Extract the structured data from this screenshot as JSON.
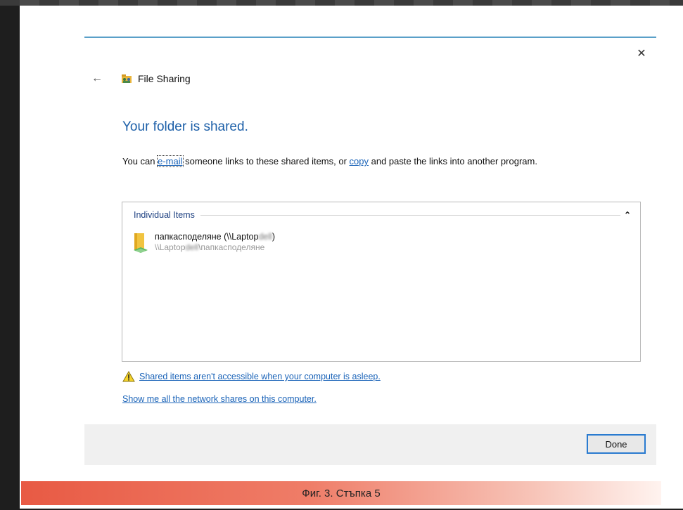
{
  "dialog": {
    "close_glyph": "✕",
    "back_glyph": "←",
    "app_title": "File Sharing",
    "heading": "Your folder is shared.",
    "desc_before": "You can ",
    "desc_link_email": "e-mail",
    "desc_middle": " someone links to these shared items, or ",
    "desc_link_copy": "copy",
    "desc_after": " and paste the links into another program."
  },
  "items_group": {
    "label": "Individual Items",
    "chevron_glyph": "⌃",
    "items": [
      {
        "name_prefix": "папкасподеляне (\\\\Laptop",
        "name_obscured": "dell",
        "name_suffix": ")",
        "path_prefix": "\\\\Laptop",
        "path_obscured": "dell",
        "path_suffix": "\\папкасподеляне"
      }
    ]
  },
  "links": {
    "asleep_warning": "Shared items aren't accessible when your computer is asleep.",
    "show_shares": "Show me all the network shares on this computer."
  },
  "footer": {
    "done_label": "Done"
  },
  "caption": "Фиг. 3. Стъпка 5",
  "colors": {
    "heading": "#1c5fa8",
    "link": "#1a63b8",
    "accent_line": "#5aa0c8",
    "caption_bar": "#e85a44"
  }
}
